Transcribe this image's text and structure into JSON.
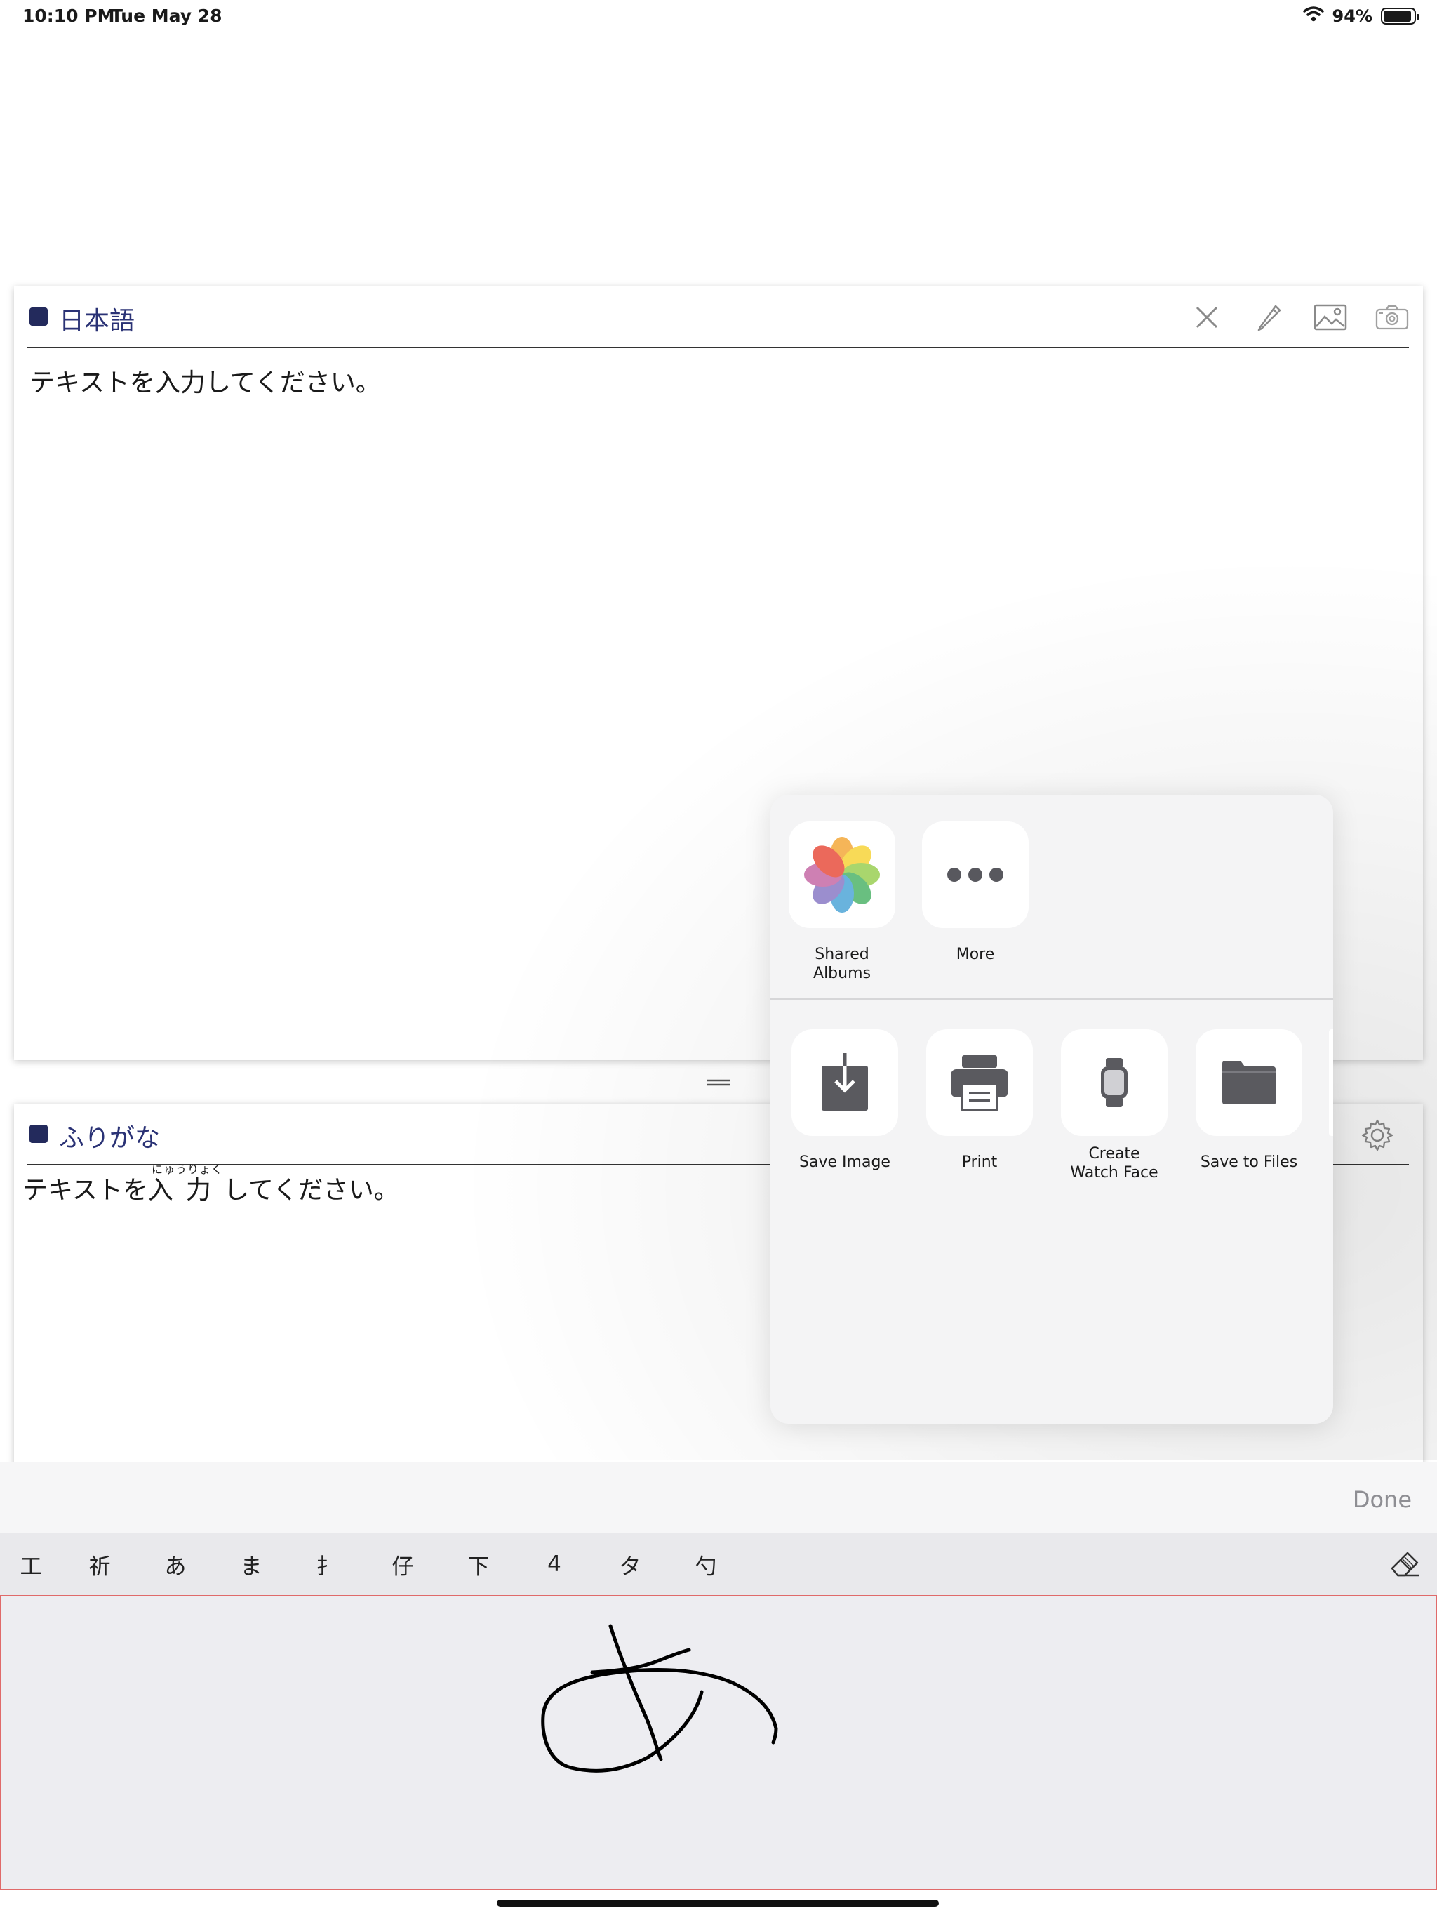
{
  "status_bar": {
    "time": "10:10 PM",
    "date": "Tue May 28",
    "battery": "94%"
  },
  "japanese_panel": {
    "title": "日本語",
    "text": "テキストを入力してください。",
    "tools": [
      "close-icon",
      "pencil-icon",
      "image-icon",
      "camera-icon"
    ]
  },
  "furigana_panel": {
    "title": "ふりがな",
    "text_before": "テキストを入",
    "text_kanji": "力",
    "text_after": "してください。",
    "ruby": "にゅうりょく"
  },
  "share_sheet": {
    "top_actions": [
      {
        "label": "Shared Albums",
        "icon": "photos-icon"
      },
      {
        "label": "More",
        "icon": "more-icon"
      }
    ],
    "bottom_actions": [
      {
        "label": "Save Image",
        "icon": "save-image-icon"
      },
      {
        "label": "Print",
        "icon": "printer-icon"
      },
      {
        "label": "Create\nWatch Face",
        "icon": "watch-icon"
      },
      {
        "label": "Save to Files",
        "icon": "folder-icon"
      }
    ]
  },
  "keyboard": {
    "done_label": "Done",
    "candidates": [
      "工",
      "祈",
      "あ",
      "ま",
      "扌",
      "仔",
      "下",
      "4",
      "タ",
      "勺"
    ]
  }
}
